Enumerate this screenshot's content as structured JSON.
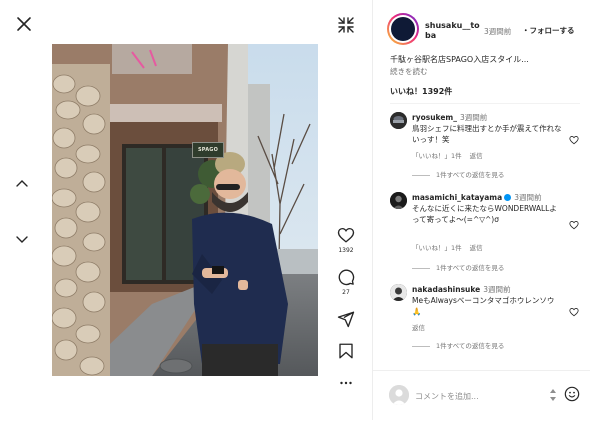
{
  "post": {
    "username": "shusaku__to",
    "username_cont": "ba",
    "time": "3週間前",
    "follow_label": "・フォローする",
    "caption": "千駄ヶ谷駅名店SPAGO入店スタイル...",
    "more_label": "続きを読む",
    "likes": "いいね！1392件",
    "shop_sign": "SPAGO"
  },
  "actions": {
    "like_count": "1392",
    "comment_count": "27"
  },
  "comments": [
    {
      "user": "ryosukem_",
      "time": "3週間前",
      "text": "鳥羽シェフに料理出すとか手が震えて作れないっす！笑",
      "likes": "「いいね！」1件",
      "reply": "返信",
      "replies": "1件すべての返信を見る"
    },
    {
      "user": "masamichi_katayama",
      "time": "3週間前",
      "text": "そんなに近くに来たならWONDERWALLよって寄ってよ〜(=^▽^)σ",
      "likes": "「いいね！」1件",
      "reply": "返信",
      "replies": "1件すべての返信を見る"
    },
    {
      "user": "nakadashinsuke",
      "time": "3週間前",
      "text": "MeもAlwaysベーコンタマゴホウレンソウ🙏",
      "reply": "返信",
      "replies": "1件すべての返信を見る"
    }
  ],
  "comment_box": {
    "placeholder": "コメントを追加..."
  },
  "colors": {
    "accent_blue": "#0095f6",
    "text_dark": "#262626",
    "text_muted": "#737373"
  },
  "icons": [
    "close-icon",
    "collapse-icon",
    "chevron-up-icon",
    "chevron-down-icon",
    "heart-icon",
    "comment-icon",
    "share-icon",
    "bookmark-icon",
    "more-icon",
    "emoji-icon"
  ]
}
